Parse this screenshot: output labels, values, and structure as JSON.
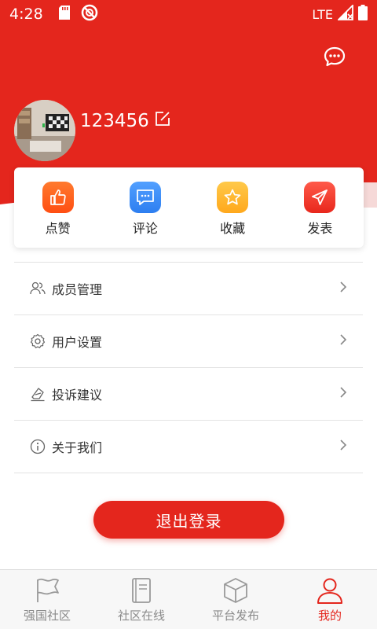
{
  "status_bar": {
    "time": "4:28",
    "network": "LTE",
    "icons": [
      "sd-card-icon",
      "sync-icon",
      "signal-icon",
      "battery-icon"
    ]
  },
  "header": {
    "chat_icon": "chat-bubble-icon"
  },
  "profile": {
    "username": "123456",
    "edit_icon": "edit-icon"
  },
  "actions": [
    {
      "label": "点赞",
      "icon": "thumbs-up-icon",
      "color": "#ff5b1a"
    },
    {
      "label": "评论",
      "icon": "comment-icon",
      "color": "#3a8af5"
    },
    {
      "label": "收藏",
      "icon": "star-icon",
      "color": "#ffb531"
    },
    {
      "label": "发表",
      "icon": "send-icon",
      "color": "#ee3a30"
    }
  ],
  "menu": [
    {
      "label": "成员管理",
      "icon": "members-icon"
    },
    {
      "label": "用户设置",
      "icon": "gear-icon"
    },
    {
      "label": "投诉建议",
      "icon": "feedback-icon"
    },
    {
      "label": "关于我们",
      "icon": "info-icon"
    }
  ],
  "logout_label": "退出登录",
  "bottom_nav": [
    {
      "label": "强国社区",
      "icon": "flag-icon",
      "active": false
    },
    {
      "label": "社区在线",
      "icon": "book-icon",
      "active": false
    },
    {
      "label": "平台发布",
      "icon": "box-icon",
      "active": false
    },
    {
      "label": "我的",
      "icon": "user-icon",
      "active": true
    }
  ],
  "colors": {
    "primary": "#e4261d",
    "inactive": "#8a8a8a"
  }
}
